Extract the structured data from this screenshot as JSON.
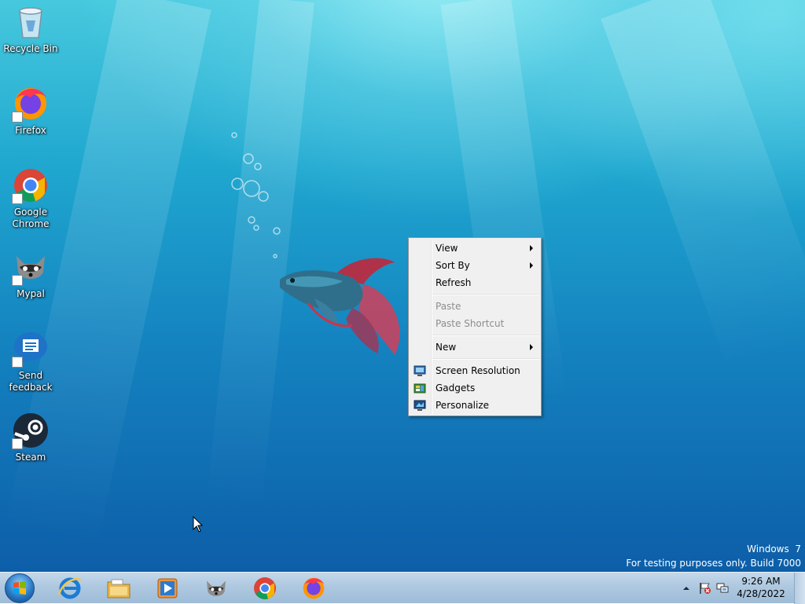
{
  "desktop_icons": [
    {
      "label": "Recycle Bin",
      "icon": "recycle-bin-icon"
    },
    {
      "label": "Firefox",
      "icon": "firefox-icon"
    },
    {
      "label": "Google Chrome",
      "icon": "chrome-icon"
    },
    {
      "label": "Mypal",
      "icon": "mypal-icon"
    },
    {
      "label": "Send feedback",
      "icon": "send-feedback-icon"
    },
    {
      "label": "Steam",
      "icon": "steam-icon"
    }
  ],
  "context_menu": {
    "items": [
      {
        "label": "View",
        "submenu": true,
        "enabled": true
      },
      {
        "label": "Sort By",
        "submenu": true,
        "enabled": true
      },
      {
        "label": "Refresh",
        "submenu": false,
        "enabled": true
      },
      {
        "label": "Paste",
        "submenu": false,
        "enabled": false
      },
      {
        "label": "Paste Shortcut",
        "submenu": false,
        "enabled": false
      },
      {
        "label": "New",
        "submenu": true,
        "enabled": true
      },
      {
        "label": "Screen Resolution",
        "icon": "screen-resolution-icon",
        "enabled": true
      },
      {
        "label": "Gadgets",
        "icon": "gadgets-icon",
        "enabled": true
      },
      {
        "label": "Personalize",
        "icon": "personalize-icon",
        "enabled": true
      }
    ]
  },
  "watermark": {
    "line1": "Windows  7",
    "line2": "For testing purposes only. Build 7000"
  },
  "taskbar": {
    "pinned": [
      "internet-explorer-icon",
      "file-explorer-icon",
      "media-player-icon",
      "mypal-icon",
      "chrome-icon",
      "firefox-icon"
    ],
    "clock": {
      "time": "9:26 AM",
      "date": "4/28/2022"
    }
  },
  "colors": {
    "accent": "#1483c0",
    "taskbar": "#aec8e0",
    "menu_bg": "#f0f0f0",
    "disabled_text": "#8d8d8d"
  }
}
